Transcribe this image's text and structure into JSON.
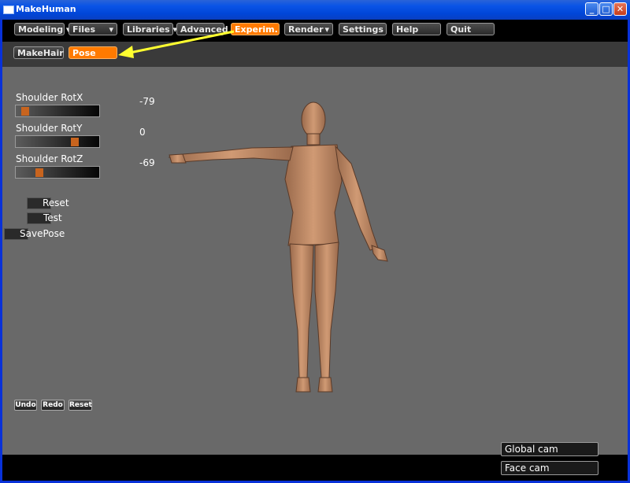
{
  "window": {
    "title": "MakeHuman"
  },
  "menu": {
    "tabs": [
      {
        "label": "Modeling ▾"
      },
      {
        "label": "Files"
      },
      {
        "label": "Libraries ▾"
      },
      {
        "label": "Advanced"
      },
      {
        "label": "Experim.",
        "active": true
      },
      {
        "label": "Render"
      },
      {
        "label": "Settings"
      },
      {
        "label": "Help"
      },
      {
        "label": "Quit"
      }
    ],
    "files_arrow": "▾",
    "render_arrow": "▾"
  },
  "subtabs": [
    {
      "label": "MakeHair"
    },
    {
      "label": "Pose",
      "active": true
    }
  ],
  "sliders": [
    {
      "label": "Shoulder RotX",
      "value": "-79",
      "level": 0.05
    },
    {
      "label": "Shoulder RotY",
      "value": "0",
      "level": 0.74
    },
    {
      "label": "Shoulder RotZ",
      "value": "-69",
      "level": 0.25
    }
  ],
  "actions": {
    "reset": "Reset",
    "test": "Test",
    "save_pose": "SavePose"
  },
  "history": {
    "undo": "Undo",
    "redo": "Redo",
    "reset": "Reset"
  },
  "cameras": {
    "global": "Global cam",
    "face": "Face cam"
  },
  "colors": {
    "accent": "#ff7a00",
    "annotation_arrow": "#ffff30",
    "viewport": "#696969",
    "skin": "#c08862"
  },
  "icons": [
    "minimize-icon",
    "maximize-icon",
    "close-icon",
    "app-window-icon"
  ]
}
